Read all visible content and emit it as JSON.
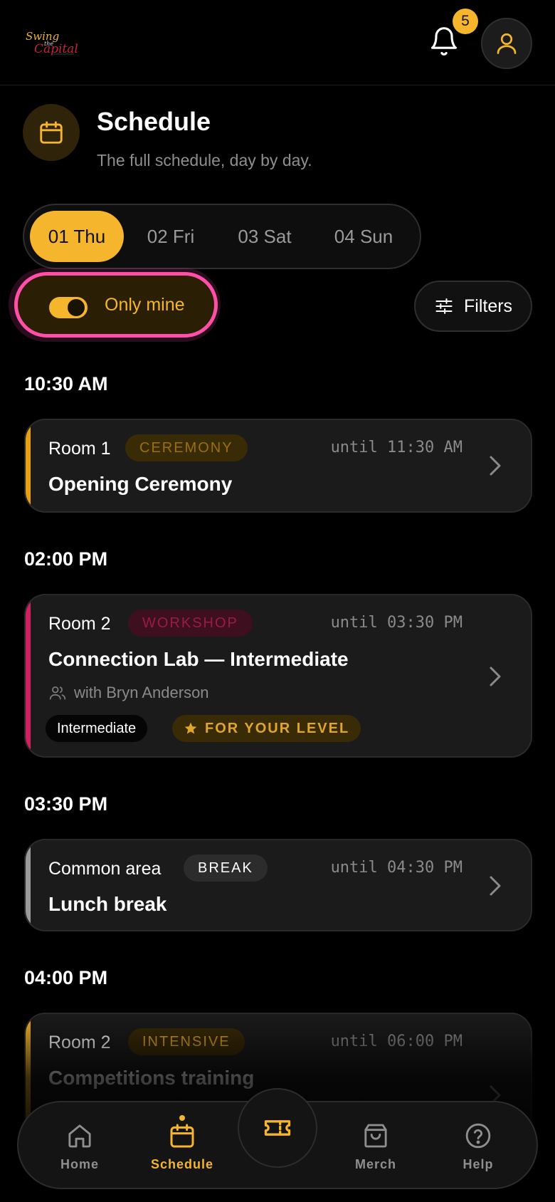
{
  "header": {
    "logo_text": "Swing the Capital",
    "notifications_count": "5"
  },
  "page": {
    "title": "Schedule",
    "subtitle": "The full schedule, day by day."
  },
  "days": [
    {
      "label": "01 Thu",
      "active": true
    },
    {
      "label": "02 Fri",
      "active": false
    },
    {
      "label": "03 Sat",
      "active": false
    },
    {
      "label": "04 Sun",
      "active": false
    }
  ],
  "controls": {
    "only_mine_label": "Only mine",
    "only_mine_on": true,
    "filters_label": "Filters"
  },
  "slots": [
    {
      "time": "10:30 AM",
      "events": [
        {
          "room": "Room 1",
          "tag": "CEREMONY",
          "until": "until 11:30 AM",
          "title": "Opening Ceremony",
          "accent": "#e7a011"
        }
      ]
    },
    {
      "time": "02:00 PM",
      "events": [
        {
          "room": "Room 2",
          "tag": "WORKSHOP",
          "until": "until 03:30 PM",
          "title": "Connection Lab — Intermediate",
          "presenter": "with Bryn Anderson",
          "level": "Intermediate",
          "highlight": "FOR YOUR LEVEL",
          "accent": "#d21f5f"
        }
      ]
    },
    {
      "time": "03:30 PM",
      "events": [
        {
          "room": "Common area",
          "tag": "BREAK",
          "until": "until 04:30 PM",
          "title": "Lunch break",
          "accent": "#9a9a9a"
        }
      ]
    },
    {
      "time": "04:00 PM",
      "events": [
        {
          "room": "Room 2",
          "tag": "INTENSIVE",
          "until": "until 06:00 PM",
          "title": "Competitions training",
          "accent": "#f5b52c"
        }
      ]
    }
  ],
  "nav": {
    "home": "Home",
    "schedule": "Schedule",
    "merch": "Merch",
    "help": "Help",
    "active": "schedule"
  },
  "colors": {
    "accent": "#f5b52c",
    "highlight_ring": "#ff4fa8",
    "workshop": "#d21f5f"
  }
}
